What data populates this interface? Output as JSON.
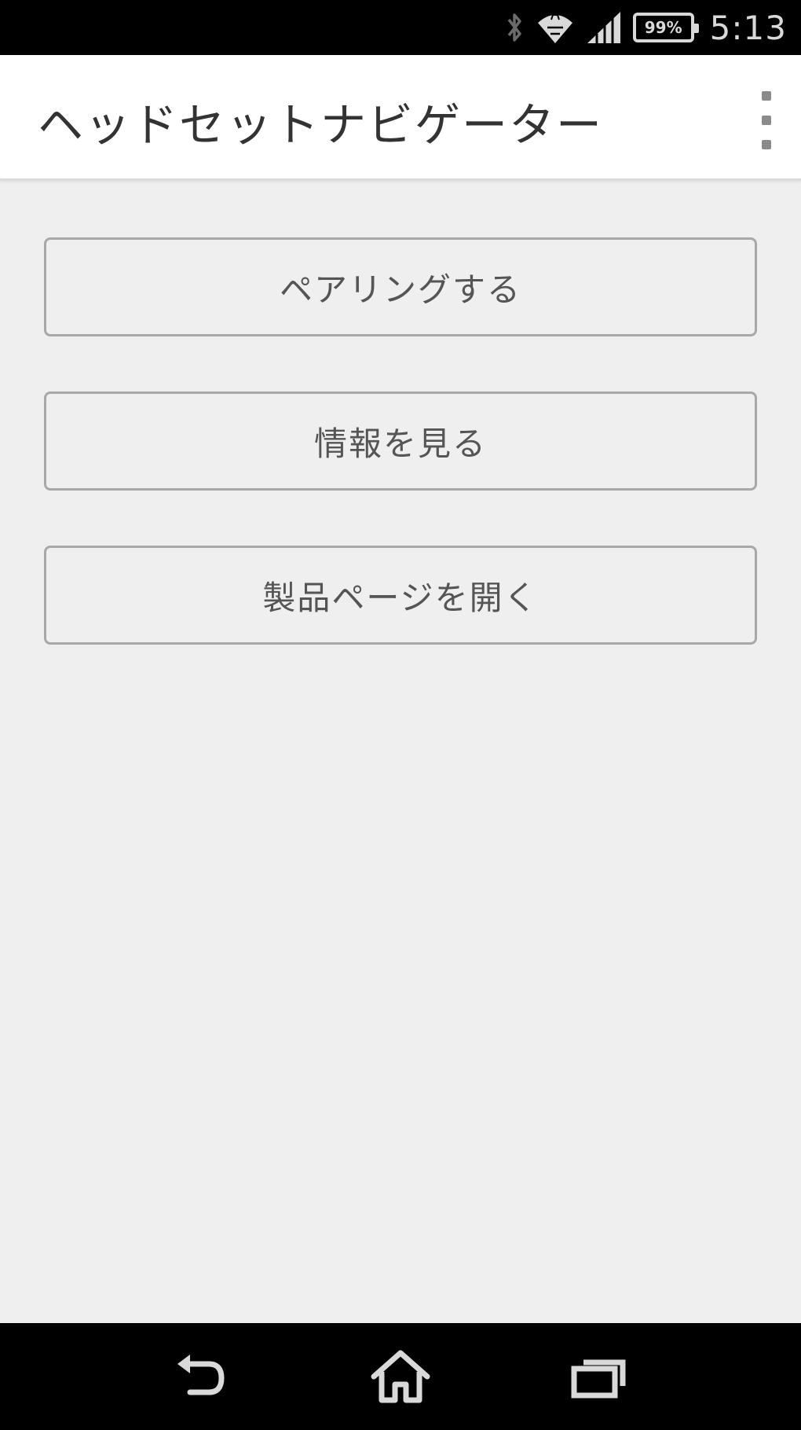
{
  "status_bar": {
    "time": "5:13",
    "battery_text": "99%",
    "icons": [
      "bluetooth-icon",
      "wifi-icon",
      "signal-icon",
      "battery-icon"
    ]
  },
  "action_bar": {
    "title": "ヘッドセットナビゲーター",
    "overflow_icon": "overflow-menu-icon"
  },
  "buttons": {
    "pairing": "ペアリングする",
    "info": "情報を見る",
    "product_page": "製品ページを開く"
  },
  "nav_bar": {
    "icons": [
      "back-icon",
      "home-icon",
      "recent-apps-icon"
    ]
  },
  "colors": {
    "background": "#efefef",
    "action_bar": "#ffffff",
    "system_bars": "#000000",
    "button_border": "#a8a8a8",
    "text": "#555555"
  }
}
